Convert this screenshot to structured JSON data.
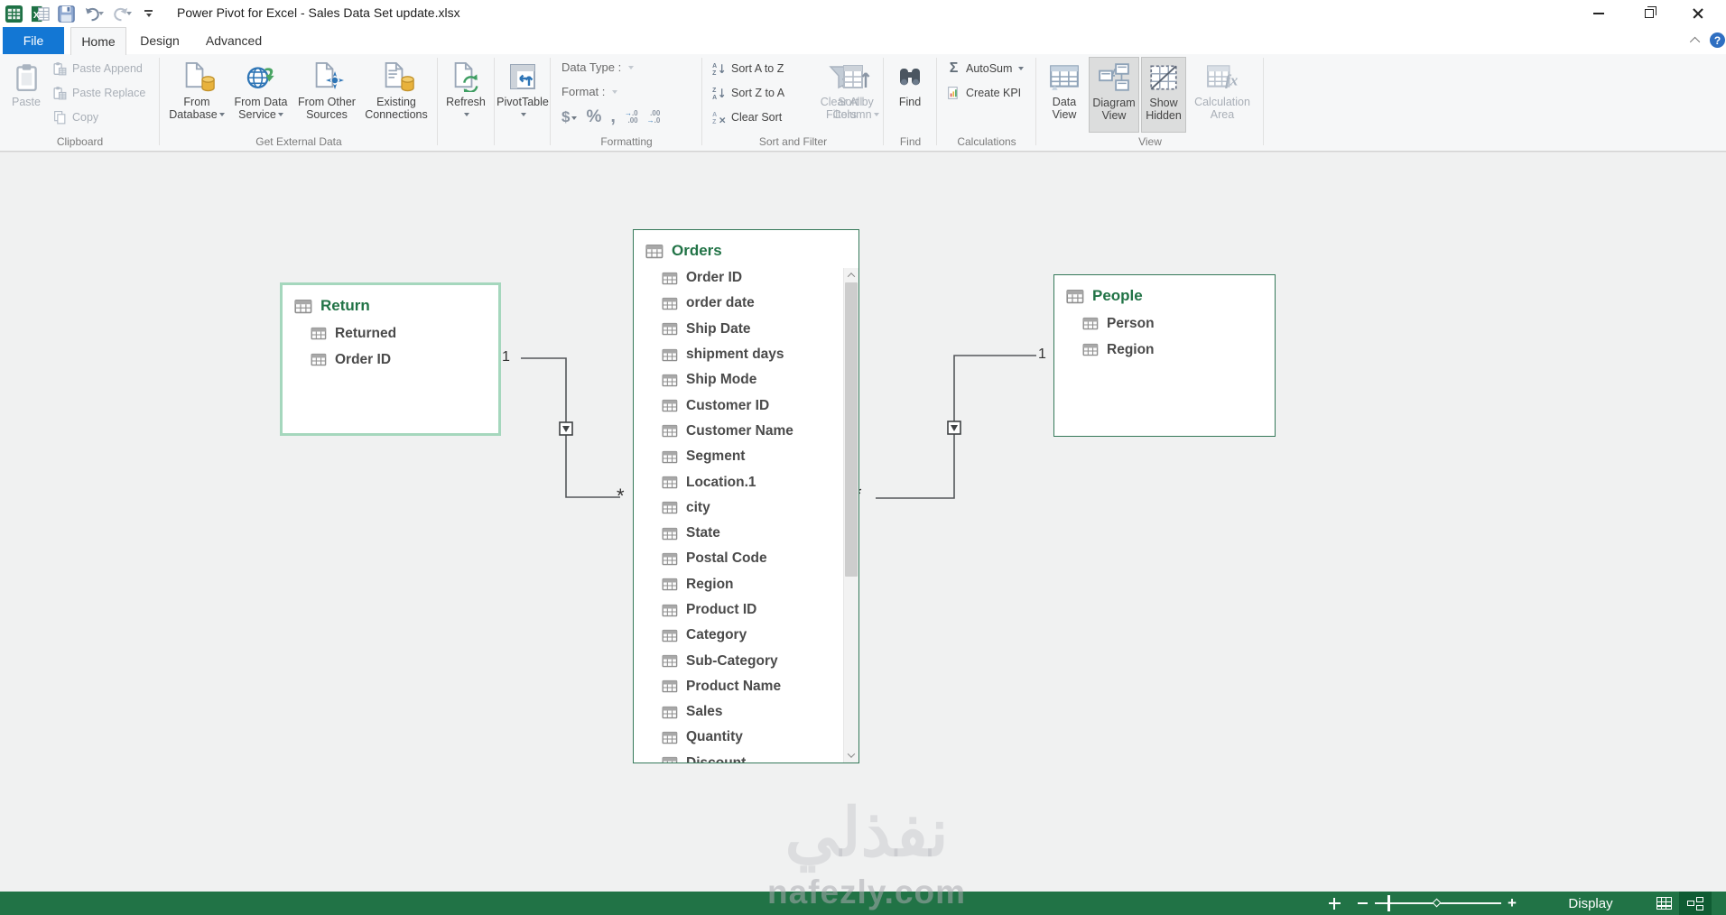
{
  "title_bar": {
    "title": "Power Pivot for Excel - Sales Data Set update.xlsx"
  },
  "tabs": {
    "file": "File",
    "home": "Home",
    "design": "Design",
    "advanced": "Advanced"
  },
  "help_icon": "?",
  "ribbon": {
    "clipboard": {
      "label": "Clipboard",
      "paste": "Paste",
      "items": [
        "Paste Append",
        "Paste Replace",
        "Copy"
      ]
    },
    "get_external_data": {
      "label": "Get External Data",
      "buttons": [
        {
          "line1": "From",
          "line2": "Database"
        },
        {
          "line1": "From Data",
          "line2": "Service"
        },
        {
          "line1": "From Other",
          "line2": "Sources"
        },
        {
          "line1": "Existing",
          "line2": "Connections"
        }
      ]
    },
    "refresh": {
      "label": "Refresh"
    },
    "pivottable": {
      "label": "PivotTable"
    },
    "formatting": {
      "label": "Formatting",
      "data_type": "Data Type :",
      "format": "Format :",
      "currency": "$",
      "percent": "%",
      "comma": ",",
      "inc_decimal_top": ".0",
      "inc_decimal_bottom": ".00",
      "dec_decimal_top": ".00",
      "dec_decimal_bottom": ".0"
    },
    "sort_and_filter": {
      "label": "Sort and Filter",
      "sort_az": "Sort A to Z",
      "sort_za": "Sort Z to A",
      "clear_sort": "Clear Sort",
      "clear_all_filters_1": "Clear All",
      "clear_all_filters_2": "Filters",
      "sort_by_column_1": "Sort by",
      "sort_by_column_2": "Column"
    },
    "find": {
      "label": "Find",
      "button": "Find"
    },
    "calculations": {
      "label": "Calculations",
      "autosum": "AutoSum",
      "autosum_icon": "Σ",
      "create_kpi": "Create KPI"
    },
    "view": {
      "label": "View",
      "buttons": [
        {
          "line1": "Data",
          "line2": "View"
        },
        {
          "line1": "Diagram",
          "line2": "View"
        },
        {
          "line1": "Show",
          "line2": "Hidden"
        },
        {
          "line1": "Calculation",
          "line2": "Area"
        }
      ]
    }
  },
  "diagram": {
    "return_table": {
      "name": "Return",
      "fields": [
        "Returned",
        "Order ID"
      ]
    },
    "orders_table": {
      "name": "Orders",
      "fields": [
        "Order ID",
        "order date",
        "Ship Date",
        "shipment days",
        "Ship Mode",
        "Customer ID",
        "Customer Name",
        "Segment",
        "Location.1",
        "city",
        "State",
        "Postal Code",
        "Region",
        "Product ID",
        "Category",
        "Sub-Category",
        "Product Name",
        "Sales",
        "Quantity",
        "Discount"
      ]
    },
    "people_table": {
      "name": "People",
      "fields": [
        "Person",
        "Region"
      ]
    },
    "relationships": [
      {
        "one": "1",
        "many": "*"
      },
      {
        "one": "1",
        "many": "*"
      }
    ]
  },
  "status_bar": {
    "display": "Display"
  },
  "watermark": {
    "arabic": "نفذلي",
    "domain": "nafezly.com"
  },
  "colors": {
    "excel_green": "#217346",
    "file_tab_blue": "#1377d4",
    "status_green": "#217346",
    "selected_table_border": "#a5d7bd",
    "table_border": "#35795a"
  }
}
